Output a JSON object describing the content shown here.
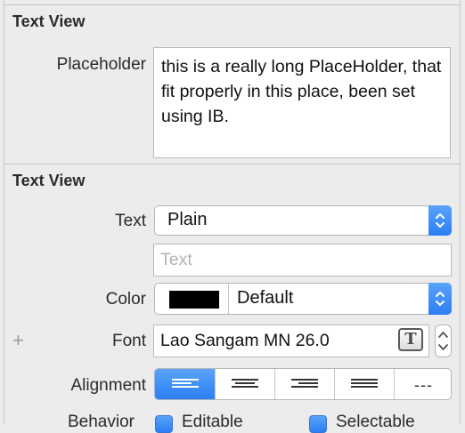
{
  "section1": {
    "title": "Text View",
    "placeholder_label": "Placeholder",
    "placeholder_value": "this is a really long PlaceHolder, that fit properly in this place, been set using IB."
  },
  "section2": {
    "title": "Text View",
    "text_label": "Text",
    "text_popup_value": "Plain",
    "text_field_placeholder": "Text",
    "color_label": "Color",
    "color_swatch": "#000000",
    "color_popup_value": "Default",
    "add_icon": "+",
    "font_label": "Font",
    "font_value": "Lao Sangam MN 26.0",
    "font_picker_glyph": "T",
    "alignment_label": "Alignment",
    "alignment_options": [
      "left",
      "center",
      "right",
      "justified",
      "natural"
    ],
    "alignment_selected": "left",
    "alignment_natural_glyph": "---",
    "behavior_label": "Behavior",
    "editable_label": "Editable",
    "selectable_label": "Selectable"
  },
  "colors": {
    "accent": "#2b7ff5",
    "panel_bg": "#ececec"
  }
}
